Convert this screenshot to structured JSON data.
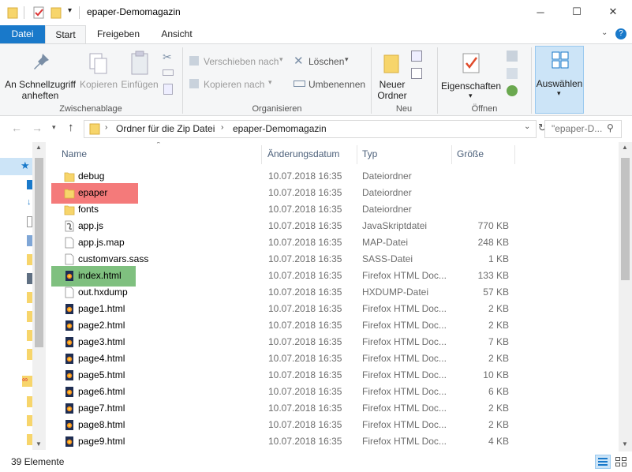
{
  "window": {
    "title": "epaper-Demomagazin",
    "minimize": "─",
    "maximize": "☐",
    "close": "✕"
  },
  "ribbon_tabs": [
    "Datei",
    "Start",
    "Freigeben",
    "Ansicht"
  ],
  "ribbon": {
    "clipboard": {
      "pin_label_1": "An Schnellzugriff",
      "pin_label_2": "anheften",
      "copy": "Kopieren",
      "paste": "Einfügen",
      "group": "Zwischenablage"
    },
    "organize": {
      "move_to": "Verschieben nach",
      "copy_to": "Kopieren nach",
      "delete": "Löschen",
      "rename": "Umbenennen",
      "group": "Organisieren"
    },
    "new": {
      "new_folder_1": "Neuer",
      "new_folder_2": "Ordner",
      "group": "Neu"
    },
    "open": {
      "properties": "Eigenschaften",
      "group": "Öffnen"
    },
    "select": {
      "select": "Auswählen"
    }
  },
  "address": {
    "crumb1": "Ordner für die Zip Datei",
    "crumb2": "epaper-Demomagazin",
    "search_placeholder": "\"epaper-D..."
  },
  "columns": {
    "name": "Name",
    "date": "Änderungsdatum",
    "type": "Typ",
    "size": "Größe"
  },
  "files": [
    {
      "name": "debug",
      "date": "10.07.2018 16:35",
      "type": "Dateiordner",
      "size": "",
      "icon": "folder-icon",
      "highlight": ""
    },
    {
      "name": "epaper",
      "date": "10.07.2018 16:35",
      "type": "Dateiordner",
      "size": "",
      "icon": "folder-icon",
      "highlight": "red"
    },
    {
      "name": "fonts",
      "date": "10.07.2018 16:35",
      "type": "Dateiordner",
      "size": "",
      "icon": "folder-icon",
      "highlight": ""
    },
    {
      "name": "app.js",
      "date": "10.07.2018 16:35",
      "type": "JavaSkriptdatei",
      "size": "770 KB",
      "icon": "js-file-icon",
      "highlight": ""
    },
    {
      "name": "app.js.map",
      "date": "10.07.2018 16:35",
      "type": "MAP-Datei",
      "size": "248 KB",
      "icon": "file-icon",
      "highlight": ""
    },
    {
      "name": "customvars.sass",
      "date": "10.07.2018 16:35",
      "type": "SASS-Datei",
      "size": "1 KB",
      "icon": "file-icon",
      "highlight": ""
    },
    {
      "name": "index.html",
      "date": "10.07.2018 16:35",
      "type": "Firefox HTML Doc...",
      "size": "133 KB",
      "icon": "html-file-icon",
      "highlight": "green"
    },
    {
      "name": "out.hxdump",
      "date": "10.07.2018 16:35",
      "type": "HXDUMP-Datei",
      "size": "57 KB",
      "icon": "file-icon",
      "highlight": ""
    },
    {
      "name": "page1.html",
      "date": "10.07.2018 16:35",
      "type": "Firefox HTML Doc...",
      "size": "2 KB",
      "icon": "html-file-icon",
      "highlight": ""
    },
    {
      "name": "page2.html",
      "date": "10.07.2018 16:35",
      "type": "Firefox HTML Doc...",
      "size": "2 KB",
      "icon": "html-file-icon",
      "highlight": ""
    },
    {
      "name": "page3.html",
      "date": "10.07.2018 16:35",
      "type": "Firefox HTML Doc...",
      "size": "7 KB",
      "icon": "html-file-icon",
      "highlight": ""
    },
    {
      "name": "page4.html",
      "date": "10.07.2018 16:35",
      "type": "Firefox HTML Doc...",
      "size": "2 KB",
      "icon": "html-file-icon",
      "highlight": ""
    },
    {
      "name": "page5.html",
      "date": "10.07.2018 16:35",
      "type": "Firefox HTML Doc...",
      "size": "10 KB",
      "icon": "html-file-icon",
      "highlight": ""
    },
    {
      "name": "page6.html",
      "date": "10.07.2018 16:35",
      "type": "Firefox HTML Doc...",
      "size": "6 KB",
      "icon": "html-file-icon",
      "highlight": ""
    },
    {
      "name": "page7.html",
      "date": "10.07.2018 16:35",
      "type": "Firefox HTML Doc...",
      "size": "2 KB",
      "icon": "html-file-icon",
      "highlight": ""
    },
    {
      "name": "page8.html",
      "date": "10.07.2018 16:35",
      "type": "Firefox HTML Doc...",
      "size": "2 KB",
      "icon": "html-file-icon",
      "highlight": ""
    },
    {
      "name": "page9.html",
      "date": "10.07.2018 16:35",
      "type": "Firefox HTML Doc...",
      "size": "4 KB",
      "icon": "html-file-icon",
      "highlight": ""
    }
  ],
  "status": {
    "count": "39 Elemente"
  },
  "colors": {
    "accent": "#1979ca",
    "highlight_red": "#f47a7a",
    "highlight_green": "#7fc07f"
  }
}
